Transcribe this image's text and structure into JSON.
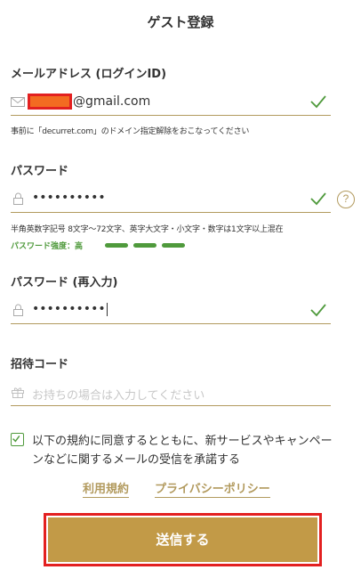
{
  "page": {
    "title": "ゲスト登録"
  },
  "email": {
    "label": "メールアドレス (ログインID)",
    "value_suffix": "@gmail.com",
    "note": "事前に「decurret.com」のドメイン指定解除をおこなってください",
    "icon": "mail-icon",
    "valid": true
  },
  "password": {
    "label": "パスワード",
    "value": "••••••••••",
    "rule": "半角英数字記号 8文字〜72文字、英字大文字・小文字・数字は1文字以上混在",
    "strength_label": "パスワード強度：高",
    "strength_level": 3,
    "help_symbol": "?",
    "icon": "lock-icon",
    "valid": true
  },
  "password_confirm": {
    "label": "パスワード (再入力)",
    "value": "••••••••••",
    "icon": "lock-icon",
    "valid": true
  },
  "invite": {
    "label": "招待コード",
    "placeholder": "お持ちの場合は入力してください",
    "icon": "gift-icon"
  },
  "agreement": {
    "checked": true,
    "text": "以下の規約に同意するとともに、新サービスやキャンペーンなどに関するメールの受信を承諾する"
  },
  "links": {
    "terms": "利用規約",
    "privacy": "プライバシーポリシー"
  },
  "submit": {
    "label": "送信する"
  },
  "colors": {
    "accent": "#c29a47",
    "underline": "#b29a5e",
    "valid": "#4f9a3c",
    "highlight": "#e32020"
  }
}
